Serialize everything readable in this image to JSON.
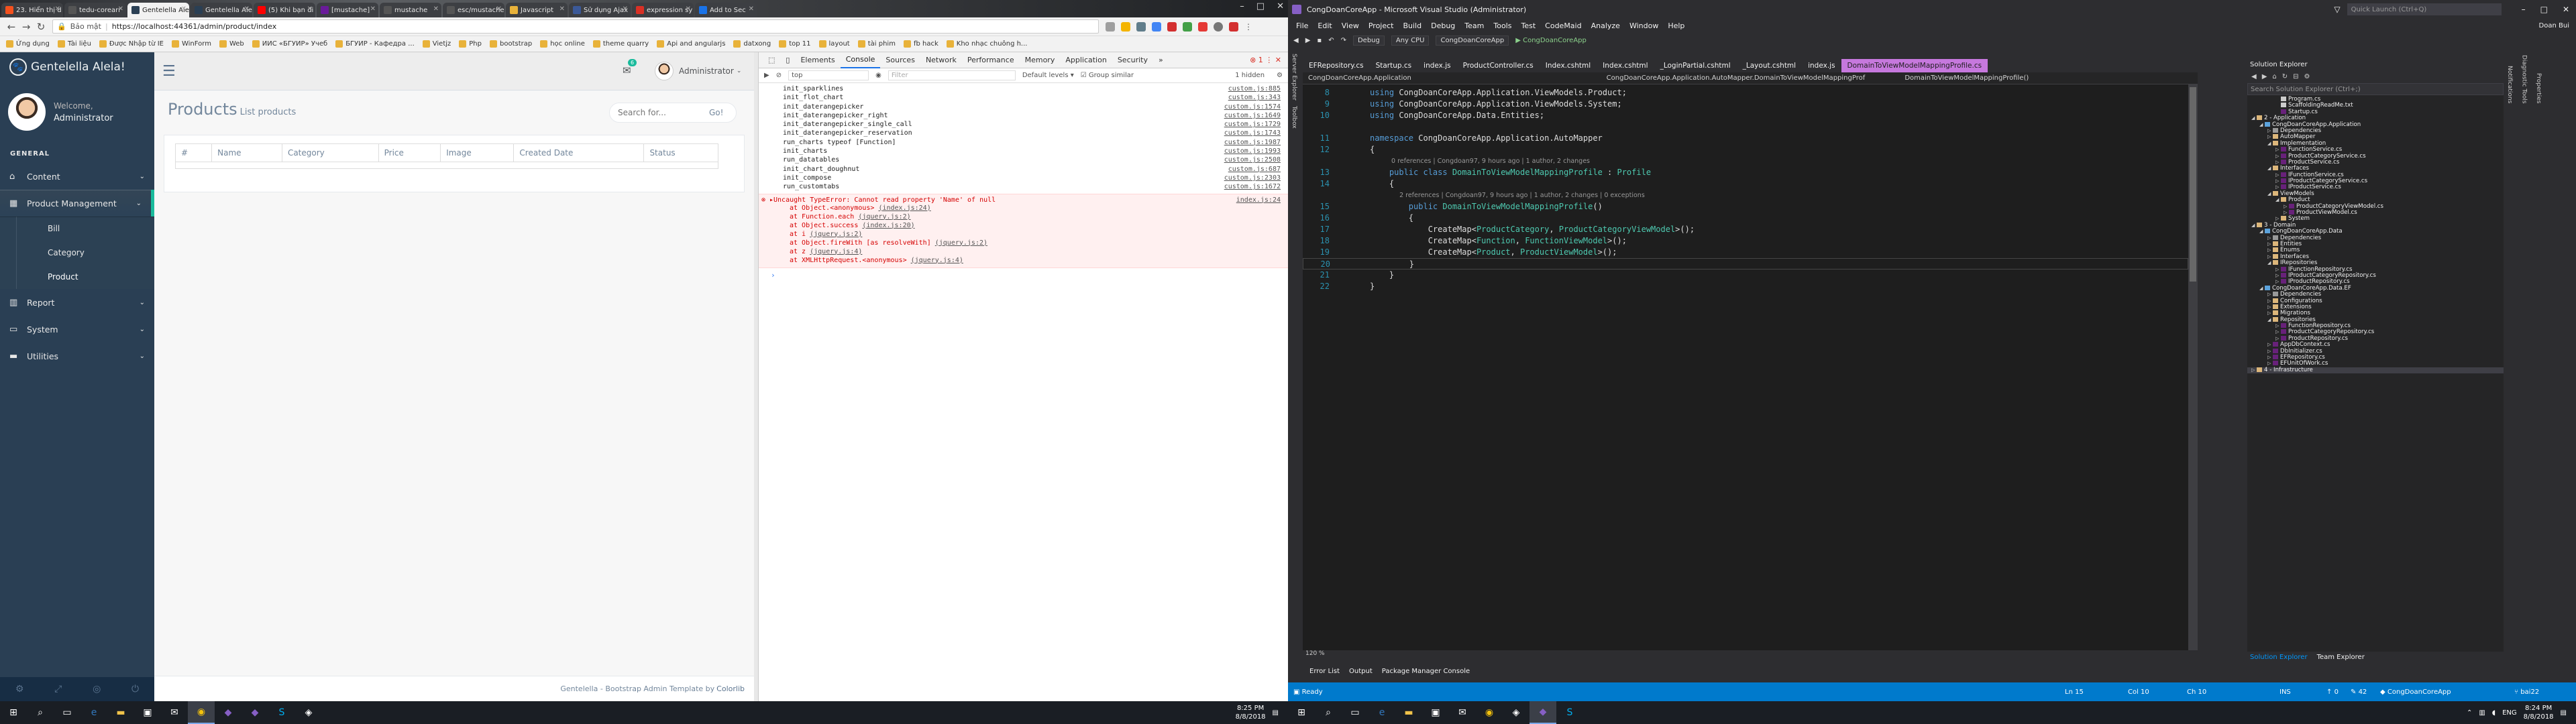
{
  "chrome": {
    "tabs": [
      {
        "label": "23. Hiển thị d",
        "color": "#f4511e"
      },
      {
        "label": "tedu-corearr",
        "color": "#555"
      },
      {
        "label": "Gentelella Ale",
        "color": "#2a3f54",
        "active": true
      },
      {
        "label": "Gentelella Ale",
        "color": "#2a3f54"
      },
      {
        "label": "(5) Khi bạn đi",
        "color": "#ff0000"
      },
      {
        "label": "[mustache]",
        "color": "#6a1b9a"
      },
      {
        "label": "mustache",
        "color": "#555"
      },
      {
        "label": "esc/mustache",
        "color": "#555"
      },
      {
        "label": "Javascript",
        "color": "#e8b23a"
      },
      {
        "label": "Sử dụng Ajax",
        "color": "#3b5998"
      },
      {
        "label": "expression sy",
        "color": "#d93025"
      },
      {
        "label": "Add to Sec",
        "color": "#1a73e8"
      }
    ],
    "address": {
      "secure": "Bảo mật",
      "url": "https://localhost:44361/admin/product/index"
    },
    "bookmarks": [
      "Ứng dụng",
      "Tài liệu",
      "Được Nhập từ IE",
      "WinForm",
      "Web",
      "ИИС «БГУИР» Учеб",
      "БГУИР - Кафедра ...",
      "Vietjz",
      "Php",
      "bootstrap",
      "học online",
      "theme quarry",
      "Api and angularjs",
      "datxong",
      "top 11",
      "layout",
      "tài phim",
      "fb hack",
      "Kho nhạc chuông h..."
    ]
  },
  "sidebar": {
    "brand": "Gentelella Alela!",
    "welcome": "Welcome,",
    "user": "Administrator",
    "section": "GENERAL",
    "items": [
      {
        "label": "Content",
        "icon": "home-icon"
      },
      {
        "label": "Product Management",
        "icon": "table-icon"
      },
      {
        "label": "Report",
        "icon": "chart-icon"
      },
      {
        "label": "System",
        "icon": "desktop-icon"
      },
      {
        "label": "Utilities",
        "icon": "laptop-icon"
      }
    ],
    "sub_items": [
      "Bill",
      "Category",
      "Product"
    ]
  },
  "topnav": {
    "user": "Administrator",
    "mail_count": "6"
  },
  "content": {
    "title": "Products",
    "subtitle": "List products",
    "search_placeholder": "Search for...",
    "go": "Go!",
    "columns": [
      "#",
      "Name",
      "Category",
      "Price",
      "Image",
      "Created Date",
      "Status"
    ]
  },
  "footer": {
    "text": "Gentelella - Bootstrap Admin Template by",
    "author": "Colorlib"
  },
  "devtools": {
    "tabs": [
      "Elements",
      "Console",
      "Sources",
      "Network",
      "Performance",
      "Memory",
      "Application",
      "Security"
    ],
    "context": "top",
    "filter": "Filter",
    "levels": "Default levels ▾",
    "group": "Group similar",
    "hidden": "1 hidden",
    "logs": [
      {
        "msg": "init_sparklines",
        "src": "custom.js:885"
      },
      {
        "msg": "init_flot_chart",
        "src": "custom.js:343"
      },
      {
        "msg": "init_daterangepicker",
        "src": "custom.js:1574"
      },
      {
        "msg": "init_daterangepicker_right",
        "src": "custom.js:1649"
      },
      {
        "msg": "init_daterangepicker_single_call",
        "src": "custom.js:1729"
      },
      {
        "msg": "init_daterangepicker_reservation",
        "src": "custom.js:1743"
      },
      {
        "msg": "run_charts  typeof [Function]",
        "src": "custom.js:1987"
      },
      {
        "msg": "init_charts",
        "src": "custom.js:1993"
      },
      {
        "msg": "run_datatables",
        "src": "custom.js:2508"
      },
      {
        "msg": "init_chart_doughnut",
        "src": "custom.js:687"
      },
      {
        "msg": "init_compose",
        "src": "custom.js:2303"
      },
      {
        "msg": "run_customtabs",
        "src": "custom.js:1672"
      }
    ],
    "error": {
      "head": "▸Uncaught TypeError: Cannot read property 'Name' of null",
      "src": "index.js:24",
      "stack": [
        {
          "at": "at Object.<anonymous> ",
          "link": "(index.js:24)"
        },
        {
          "at": "at Function.each ",
          "link": "(jquery.js:2)"
        },
        {
          "at": "at Object.success ",
          "link": "(index.js:20)"
        },
        {
          "at": "at i ",
          "link": "(jquery.js:2)"
        },
        {
          "at": "at Object.fireWith [as resolveWith] ",
          "link": "(jquery.js:2)"
        },
        {
          "at": "at z ",
          "link": "(jquery.js:4)"
        },
        {
          "at": "at XMLHttpRequest.<anonymous> ",
          "link": "(jquery.js:4)"
        }
      ]
    }
  },
  "taskbar_left": {
    "time": "8:25 PM",
    "date": "8/8/2018"
  },
  "vs": {
    "title": "CongDoanCoreApp - Microsoft Visual Studio (Administrator)",
    "quick_launch": "Quick Launch (Ctrl+Q)",
    "menu": [
      "File",
      "Edit",
      "View",
      "Project",
      "Build",
      "Debug",
      "Team",
      "Tools",
      "Test",
      "CodeMaid",
      "Analyze",
      "Window",
      "Help"
    ],
    "user": "Doan Bui",
    "toolbar": {
      "config": "Debug",
      "platform": "Any CPU",
      "project": "CongDoanCoreApp",
      "run": "▶ CongDoanCoreApp"
    },
    "left_strip": [
      "Server Explorer",
      "Toolbox"
    ],
    "editor_tabs": [
      "EFRepository.cs",
      "Startup.cs",
      "index.js",
      "ProductController.cs",
      "Index.cshtml",
      "Index.cshtml",
      "_LoginPartial.cshtml",
      "_Layout.cshtml",
      "index.js",
      "DomainToViewModelMappingProfile.cs"
    ],
    "nav": [
      "CongDoanCoreApp.Application",
      "CongDoanCoreApp.Application.AutoMapper.DomainToViewModelMappingProf",
      "DomainToViewModelMappingProfile()"
    ],
    "zoom": "120 %",
    "output_tabs": [
      "Error List",
      "Output",
      "Package Manager Console"
    ],
    "status": {
      "ready": "Ready",
      "ln": "Ln 15",
      "col": "Col 10",
      "ch": "Ch 10",
      "ins": "INS",
      "errors": "0",
      "pending": "42",
      "project": "CongDoanCoreApp",
      "branch": "bai22"
    },
    "right_strip": [
      "Notifications",
      "Diagnostic Tools",
      "Properties"
    ],
    "se_title": "Solution Explorer",
    "se_search": "Search Solution Explorer (Ctrl+;)",
    "se_foot": [
      "Solution Explorer",
      "Team Explorer"
    ]
  },
  "code": [
    {
      "n": "8",
      "parts": [
        [
          "kw",
          "using "
        ],
        [
          "ns",
          "CongDoanCoreApp.Application.ViewModels.Product;"
        ]
      ]
    },
    {
      "n": "9",
      "parts": [
        [
          "kw",
          "using "
        ],
        [
          "ns",
          "CongDoanCoreApp.Application.ViewModels.System;"
        ]
      ]
    },
    {
      "n": "10",
      "parts": [
        [
          "kw",
          "using "
        ],
        [
          "ns",
          "CongDoanCoreApp.Data.Entities;"
        ]
      ]
    },
    {
      "n": "",
      "parts": []
    },
    {
      "n": "11",
      "parts": [
        [
          "kw",
          "namespace "
        ],
        [
          "ns",
          "CongDoanCoreApp.Application.AutoMapper"
        ]
      ]
    },
    {
      "n": "12",
      "parts": [
        [
          "ns",
          "{"
        ]
      ]
    },
    {
      "n": "",
      "lens": "0 references | Congdoan97, 9 hours ago | 1 author, 2 changes"
    },
    {
      "n": "13",
      "parts": [
        [
          "kw",
          "    public class "
        ],
        [
          "ty",
          "DomainToViewModelMappingProfile"
        ],
        [
          "ns",
          " : "
        ],
        [
          "ty",
          "Profile"
        ]
      ]
    },
    {
      "n": "14",
      "parts": [
        [
          "ns",
          "    {"
        ]
      ]
    },
    {
      "n": "",
      "lens": "    2 references | Congdoan97, 9 hours ago | 1 author, 2 changes | 0 exceptions"
    },
    {
      "n": "15",
      "parts": [
        [
          "kw",
          "        public "
        ],
        [
          "ty",
          "DomainToViewModelMappingProfile"
        ],
        [
          "ns",
          "()"
        ]
      ]
    },
    {
      "n": "16",
      "parts": [
        [
          "ns",
          "        {"
        ]
      ]
    },
    {
      "n": "17",
      "parts": [
        [
          "ns",
          "            CreateMap<"
        ],
        [
          "ty",
          "ProductCategory"
        ],
        [
          "ns",
          ", "
        ],
        [
          "ty",
          "ProductCategoryViewModel"
        ],
        [
          "ns",
          ">();"
        ]
      ]
    },
    {
      "n": "18",
      "parts": [
        [
          "ns",
          "            CreateMap<"
        ],
        [
          "ty",
          "Function"
        ],
        [
          "ns",
          ", "
        ],
        [
          "ty",
          "FunctionViewModel"
        ],
        [
          "ns",
          ">();"
        ]
      ]
    },
    {
      "n": "19",
      "parts": [
        [
          "ns",
          "            CreateMap<"
        ],
        [
          "ty",
          "Product"
        ],
        [
          "ns",
          ", "
        ],
        [
          "ty",
          "ProductViewModel"
        ],
        [
          "ns",
          ">();"
        ]
      ]
    },
    {
      "n": "20",
      "parts": [
        [
          "ns",
          "        }"
        ]
      ]
    },
    {
      "n": "21",
      "parts": [
        [
          "ns",
          "    }"
        ]
      ]
    },
    {
      "n": "22",
      "parts": [
        [
          "ns",
          "}"
        ]
      ]
    }
  ],
  "tree": [
    {
      "d": 3,
      "t": "file",
      "l": "Program.cs"
    },
    {
      "d": 3,
      "t": "file",
      "l": "ScaffoldingReadMe.txt"
    },
    {
      "d": 3,
      "t": "cs",
      "l": "Startup.cs"
    },
    {
      "d": 0,
      "t": "fold",
      "l": "2 - Application",
      "o": true
    },
    {
      "d": 1,
      "t": "proj",
      "l": "CongDoanCoreApp.Application",
      "o": true
    },
    {
      "d": 2,
      "t": "ref",
      "l": "Dependencies",
      "c": true
    },
    {
      "d": 2,
      "t": "fold",
      "l": "AutoMapper",
      "c": true
    },
    {
      "d": 2,
      "t": "fold",
      "l": "Implementation",
      "o": true
    },
    {
      "d": 3,
      "t": "cs",
      "l": "FunctionService.cs",
      "c": true
    },
    {
      "d": 3,
      "t": "cs",
      "l": "ProductCategoryService.cs",
      "c": true
    },
    {
      "d": 3,
      "t": "cs",
      "l": "ProductService.cs",
      "c": true
    },
    {
      "d": 2,
      "t": "fold",
      "l": "Interfaces",
      "o": true
    },
    {
      "d": 3,
      "t": "cs",
      "l": "IFunctionService.cs",
      "c": true
    },
    {
      "d": 3,
      "t": "cs",
      "l": "IProductCategoryService.cs",
      "c": true
    },
    {
      "d": 3,
      "t": "cs",
      "l": "IProductService.cs",
      "c": true
    },
    {
      "d": 2,
      "t": "fold",
      "l": "ViewModels",
      "o": true
    },
    {
      "d": 3,
      "t": "fold",
      "l": "Product",
      "o": true
    },
    {
      "d": 4,
      "t": "cs",
      "l": "ProductCategoryViewModel.cs",
      "c": true
    },
    {
      "d": 4,
      "t": "cs",
      "l": "ProductViewModel.cs",
      "c": true
    },
    {
      "d": 3,
      "t": "fold",
      "l": "System",
      "c": true
    },
    {
      "d": 0,
      "t": "fold",
      "l": "3 - Domain",
      "o": true
    },
    {
      "d": 1,
      "t": "proj",
      "l": "CongDoanCoreApp.Data",
      "o": true
    },
    {
      "d": 2,
      "t": "ref",
      "l": "Dependencies",
      "c": true
    },
    {
      "d": 2,
      "t": "fold",
      "l": "Entities",
      "c": true
    },
    {
      "d": 2,
      "t": "fold",
      "l": "Enums",
      "c": true
    },
    {
      "d": 2,
      "t": "fold",
      "l": "Interfaces",
      "c": true
    },
    {
      "d": 2,
      "t": "fold",
      "l": "IRepositories",
      "o": true
    },
    {
      "d": 3,
      "t": "cs",
      "l": "IFunctionRepository.cs",
      "c": true
    },
    {
      "d": 3,
      "t": "cs",
      "l": "IProductCategoryRepository.cs",
      "c": true
    },
    {
      "d": 3,
      "t": "cs",
      "l": "IProductRepository.cs",
      "c": true
    },
    {
      "d": 1,
      "t": "proj",
      "l": "CongDoanCoreApp.Data.EF",
      "o": true
    },
    {
      "d": 2,
      "t": "ref",
      "l": "Dependencies",
      "c": true
    },
    {
      "d": 2,
      "t": "fold",
      "l": "Configurations",
      "c": true
    },
    {
      "d": 2,
      "t": "fold",
      "l": "Extensions",
      "c": true
    },
    {
      "d": 2,
      "t": "fold",
      "l": "Migrations",
      "c": true
    },
    {
      "d": 2,
      "t": "fold",
      "l": "Repositories",
      "o": true
    },
    {
      "d": 3,
      "t": "cs",
      "l": "FunctionRepository.cs",
      "c": true
    },
    {
      "d": 3,
      "t": "cs",
      "l": "ProductCategoryRepository.cs",
      "c": true
    },
    {
      "d": 3,
      "t": "cs",
      "l": "ProductRepository.cs",
      "c": true
    },
    {
      "d": 2,
      "t": "cs",
      "l": "AppDbContext.cs",
      "c": true
    },
    {
      "d": 2,
      "t": "cs",
      "l": "DbInitializer.cs",
      "c": true
    },
    {
      "d": 2,
      "t": "cs",
      "l": "EFRepository.cs",
      "c": true
    },
    {
      "d": 2,
      "t": "cs",
      "l": "EFUnitOfWork.cs",
      "c": true
    },
    {
      "d": 0,
      "t": "fold",
      "l": "4 - Infrastructure",
      "c": true,
      "sel": true
    }
  ],
  "taskbar_right": {
    "time": "8:24 PM",
    "date": "8/8/2018",
    "lang": "ENG"
  }
}
